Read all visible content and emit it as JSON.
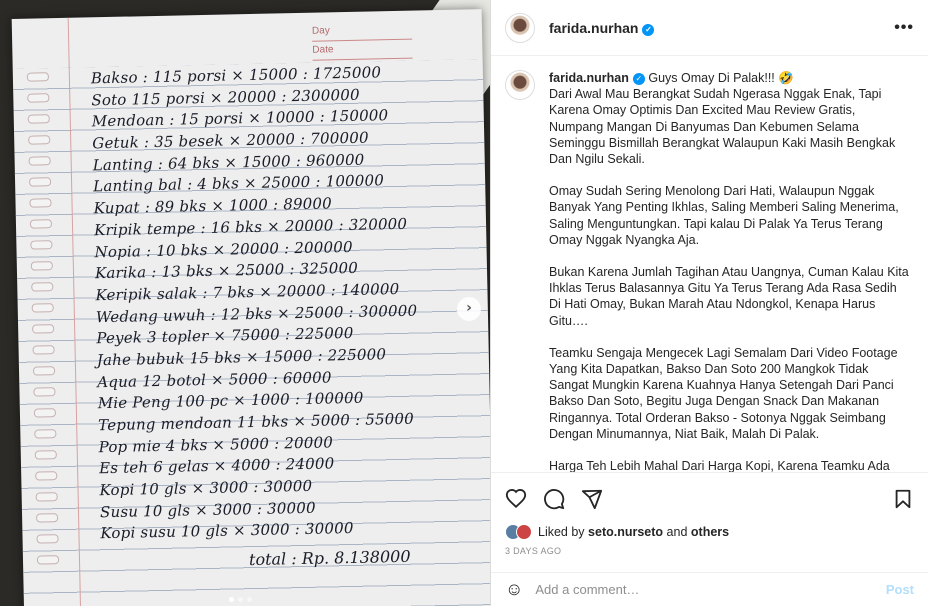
{
  "photo": {
    "header_labels": [
      "Day",
      "Date"
    ],
    "lines": [
      "Bakso : 115 porsi × 15000 : 1725000",
      "Soto  115 porsi × 20000 : 2300000",
      "Mendoan : 15 porsi × 10000 : 150000",
      "Getuk : 35 besek × 20000 : 700000",
      "Lanting : 64 bks × 15000 : 960000",
      "Lanting bal : 4 bks × 25000 : 100000",
      "Kupat : 89 bks × 1000 : 89000",
      "Kripik tempe : 16 bks × 20000 : 320000",
      "Nopia : 10 bks × 20000 : 200000",
      "Karika : 13 bks × 25000 : 325000",
      "Keripik salak : 7 bks × 20000 : 140000",
      "Wedang uwuh : 12 bks × 25000 : 300000",
      "Peyek 3 topler × 75000 : 225000",
      "Jahe bubuk 15 bks × 15000 : 225000",
      "Aqua  12 botol × 5000 : 60000",
      "Mie Peng 100 pc × 1000 : 100000",
      "Tepung mendoan 11 bks × 5000 : 55000",
      "Pop mie  4 bks × 5000 : 20000",
      "Es teh  6 gelas × 4000 : 24000",
      "Kopi  10 gls × 3000 : 30000",
      "Susu  10 gls × 3000 : 30000",
      "Kopi susu 10 gls × 3000 : 30000"
    ],
    "total": "total : Rp. 8.138000",
    "next_glyph": "›"
  },
  "header": {
    "username": "farida.nurhan",
    "verified_glyph": "✓",
    "more_glyph": "•••"
  },
  "caption": {
    "username": "farida.nurhan",
    "verified_glyph": "✓",
    "first_line": "Guys Omay Di Palak!!! 🤣",
    "paragraphs": [
      "Dari Awal Mau Berangkat Sudah Ngerasa Nggak Enak, Tapi Karena Omay Optimis Dan Excited Mau Review Gratis, Numpang Mangan Di Banyumas Dan Kebumen Selama Seminggu Bismillah Berangkat Walaupun Kaki Masih Bengkak Dan Ngilu Sekali.",
      "Omay Sudah Sering Menolong Dari Hati, Walaupun Nggak Banyak Yang Penting Ikhlas, Saling Memberi Saling Menerima, Saling Menguntungkan. Tapi kalau Di Palak Ya Terus Terang Omay Nggak Nyangka Aja.",
      "Bukan Karena Jumlah Tagihan Atau Uangnya, Cuman Kalau Kita Ihklas Terus Balasannya Gitu Ya Terus Terang Ada Rasa Sedih Di Hati Omay, Bukan Marah Atau Ndongkol, Kenapa Harus Gitu….",
      "Teamku Sengaja Mengecek Lagi Semalam Dari Video Footage Yang Kita Dapatkan, Bakso Dan Soto 200 Mangkok Tidak Sangat Mungkin Karena Kuahnya Hanya Setengah Dari Panci Bakso Dan Soto, Begitu Juga Dengan Snack Dan Makanan Ringannya. Total Orderan Bakso - Sotonya Nggak Seimbang Dengan Minumannya, Niat Baik, Malah Di Palak.",
      "Harga Teh Lebih Mahal Dari Harga Kopi, Karena Teamku Ada"
    ]
  },
  "actions": {
    "like_icon": "heart-icon",
    "comment_icon": "comment-icon",
    "share_icon": "share-icon",
    "save_icon": "bookmark-icon"
  },
  "likes": {
    "prefix": "Liked by",
    "user": "seto.nurseto",
    "middle": "and",
    "others": "others"
  },
  "date": "3 DAYS AGO",
  "comment": {
    "placeholder": "Add a comment…",
    "post_label": "Post",
    "emoji_glyph": "☺"
  }
}
